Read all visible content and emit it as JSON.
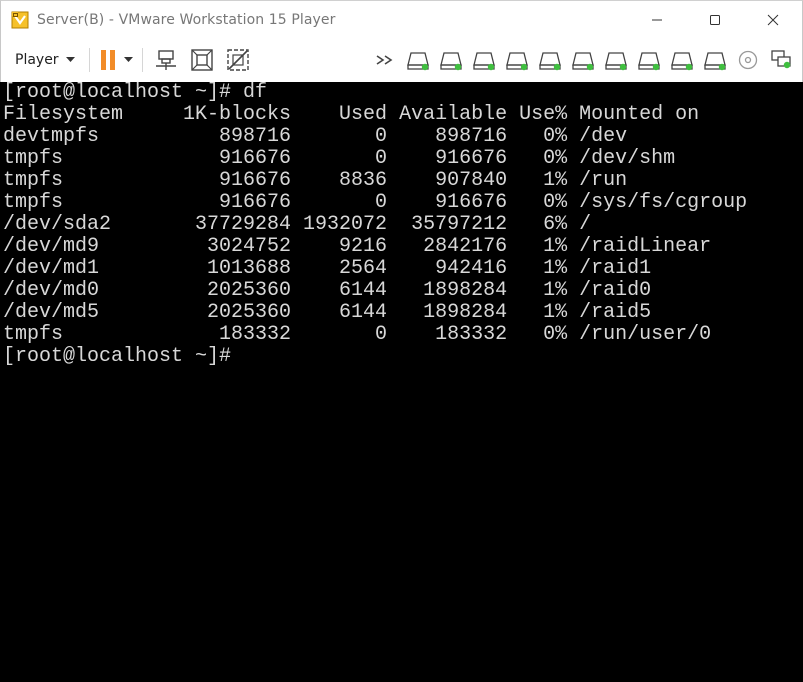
{
  "window": {
    "title": "Server(B) - VMware Workstation 15 Player"
  },
  "toolbar": {
    "player_label": "Player"
  },
  "terminal": {
    "lines": [
      "[root@localhost ~]# df",
      "Filesystem     1K-blocks    Used Available Use% Mounted on",
      "devtmpfs          898716       0    898716   0% /dev",
      "tmpfs             916676       0    916676   0% /dev/shm",
      "tmpfs             916676    8836    907840   1% /run",
      "tmpfs             916676       0    916676   0% /sys/fs/cgroup",
      "/dev/sda2       37729284 1932072  35797212   6% /",
      "/dev/md9         3024752    9216   2842176   1% /raidLinear",
      "/dev/md1         1013688    2564    942416   1% /raid1",
      "/dev/md0         2025360    6144   1898284   1% /raid0",
      "/dev/md5         2025360    6144   1898284   1% /raid5",
      "tmpfs             183332       0    183332   0% /run/user/0",
      "[root@localhost ~]#"
    ]
  },
  "colors": {
    "accent_orange": "#f28c28",
    "device_green": "#3fbf3f",
    "terminal_text": "#d8d8d8",
    "terminal_bg": "#000000"
  },
  "icons": {
    "app": "vmware-player-icon",
    "minimize": "minimize-icon",
    "maximize": "maximize-icon",
    "close": "close-icon",
    "pause": "pause-icon",
    "send_ctrl_alt_del": "send-keys-icon",
    "fit_guest": "fit-window-icon",
    "unity": "unity-icon",
    "more_devices": "more-devices-icon",
    "hard_disk": "hard-disk-icon",
    "cd": "cd-icon",
    "network": "network-icon"
  }
}
